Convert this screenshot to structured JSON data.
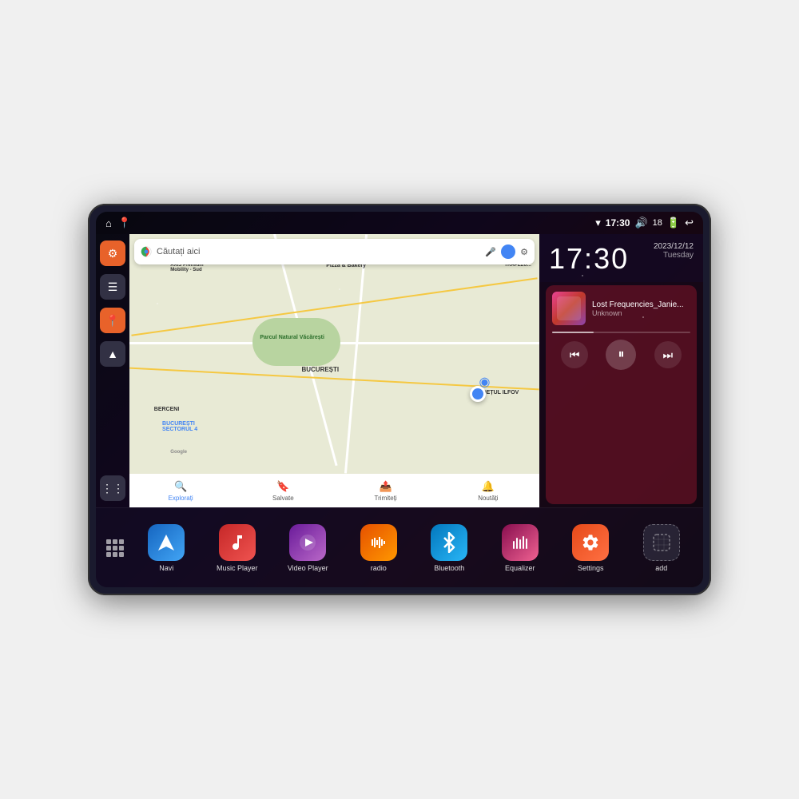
{
  "device": {
    "status_bar": {
      "left_icons": [
        "home",
        "maps"
      ],
      "wifi_icon": "wifi",
      "time": "17:30",
      "volume_icon": "volume",
      "battery_level": "18",
      "battery_icon": "battery",
      "back_icon": "back"
    },
    "clock": {
      "time": "17:30",
      "date": "2023/12/12",
      "day": "Tuesday"
    },
    "music": {
      "title": "Lost Frequencies_Janie...",
      "artist": "Unknown",
      "cover_alt": "music cover"
    },
    "map": {
      "search_placeholder": "Căutați aici",
      "labels": [
        "AXIS Premium Mobility - Sud",
        "Pizza & Bakery",
        "TRAPEZU...",
        "Parcul Natural Văcărești",
        "BUCUREȘTI SECTORUL 4",
        "BUCUREȘTI",
        "JUDEȚUL ILFOV",
        "BERCENI",
        "Google"
      ],
      "bottom_nav": [
        {
          "label": "Explorați",
          "icon": "🔍"
        },
        {
          "label": "Salvate",
          "icon": "🔖"
        },
        {
          "label": "Trimiteți",
          "icon": "📤"
        },
        {
          "label": "Noutăți",
          "icon": "🔔"
        }
      ]
    },
    "sidebar": {
      "items": [
        {
          "icon": "⚙️",
          "type": "orange"
        },
        {
          "icon": "📁",
          "type": "dark"
        },
        {
          "icon": "📍",
          "type": "orange"
        },
        {
          "icon": "🧭",
          "type": "dark"
        }
      ],
      "bottom": {
        "icon": "⋮⋮⋮",
        "type": "dark"
      }
    },
    "apps": [
      {
        "label": "Navi",
        "icon": "🧭",
        "color": "blue"
      },
      {
        "label": "Music Player",
        "icon": "🎵",
        "color": "red"
      },
      {
        "label": "Video Player",
        "icon": "▶",
        "color": "purple"
      },
      {
        "label": "radio",
        "icon": "📻",
        "color": "orange-dark"
      },
      {
        "label": "Bluetooth",
        "icon": "⬡",
        "color": "blue-light"
      },
      {
        "label": "Equalizer",
        "icon": "🎚",
        "color": "pink"
      },
      {
        "label": "Settings",
        "icon": "⚙️",
        "color": "orange"
      },
      {
        "label": "add",
        "icon": "+",
        "color": "gray"
      }
    ]
  }
}
